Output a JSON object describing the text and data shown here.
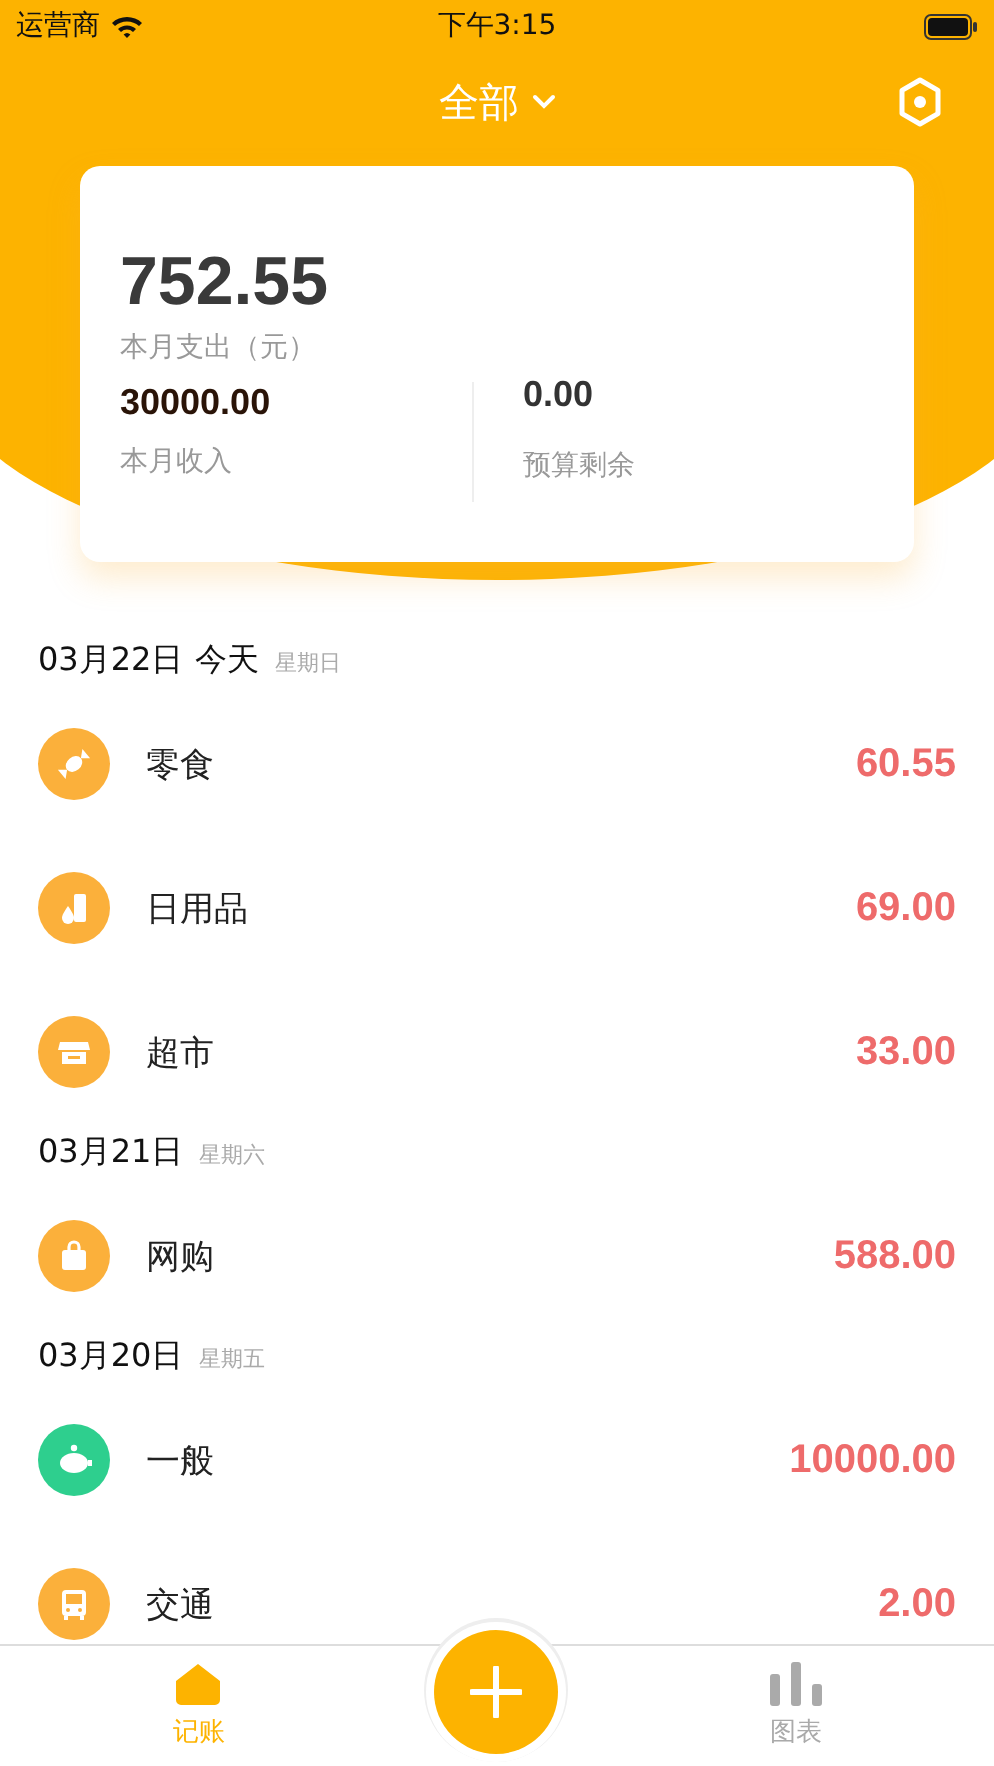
{
  "status_bar": {
    "carrier": "运营商",
    "time": "下午3:15"
  },
  "header": {
    "title": "全部"
  },
  "summary": {
    "expense": "752.55",
    "expense_label": "本月支出（元）",
    "income": "30000.00",
    "income_label": "本月收入",
    "budget": "0.00",
    "budget_label": "预算剩余"
  },
  "groups": [
    {
      "date": "03月22日",
      "today": "今天",
      "weekday": "星期日",
      "items": [
        {
          "name": "零食",
          "amount": "60.55",
          "kind": "candy",
          "color": "#fbb03b"
        },
        {
          "name": "日用品",
          "amount": "69.00",
          "kind": "bottle",
          "color": "#fbb03b"
        },
        {
          "name": "超市",
          "amount": "33.00",
          "kind": "store",
          "color": "#fbb03b"
        }
      ]
    },
    {
      "date": "03月21日",
      "weekday": "星期六",
      "items": [
        {
          "name": "网购",
          "amount": "588.00",
          "kind": "bag",
          "color": "#fbb03b"
        }
      ]
    },
    {
      "date": "03月20日",
      "weekday": "星期五",
      "items": [
        {
          "name": "一般",
          "amount": "10000.00",
          "kind": "piggy",
          "color": "#2ecf8e"
        },
        {
          "name": "交通",
          "amount": "2.00",
          "kind": "bus",
          "color": "#fbb03b"
        }
      ]
    }
  ],
  "tabs": [
    {
      "label": "记账",
      "kind": "home",
      "selected": true
    },
    {
      "label": "图表",
      "kind": "chart",
      "selected": false
    }
  ]
}
